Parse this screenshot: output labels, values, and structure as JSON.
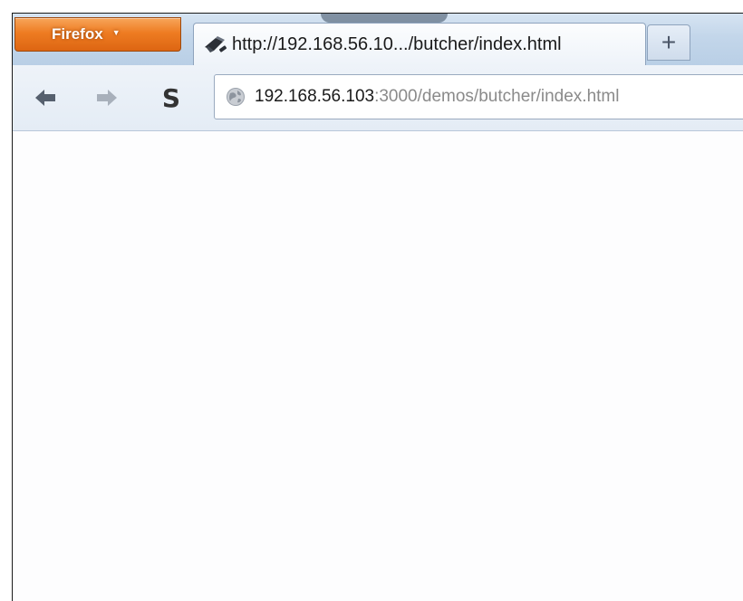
{
  "browser": {
    "menu_button_label": "Firefox",
    "menu_caret": "▼",
    "tab_title": "http://192.168.56.10.../butcher/index.html",
    "new_tab_label": "+",
    "s_button_label": "S",
    "url_host": "192.168.56.103",
    "url_path": ":3000/demos/butcher/index.html"
  },
  "icons": {
    "tab_favicon": "butcher-cleaver-icon",
    "back": "back-arrow-icon",
    "forward": "forward-arrow-icon",
    "site_identity": "globe-icon"
  },
  "colors": {
    "firefox_orange": "#ee7c22",
    "tabstrip_blue": "#c3d6ea",
    "toolbar_bg": "#eef3f9",
    "url_host_text": "#1a1a1a",
    "url_path_text": "#8a8a8a"
  }
}
